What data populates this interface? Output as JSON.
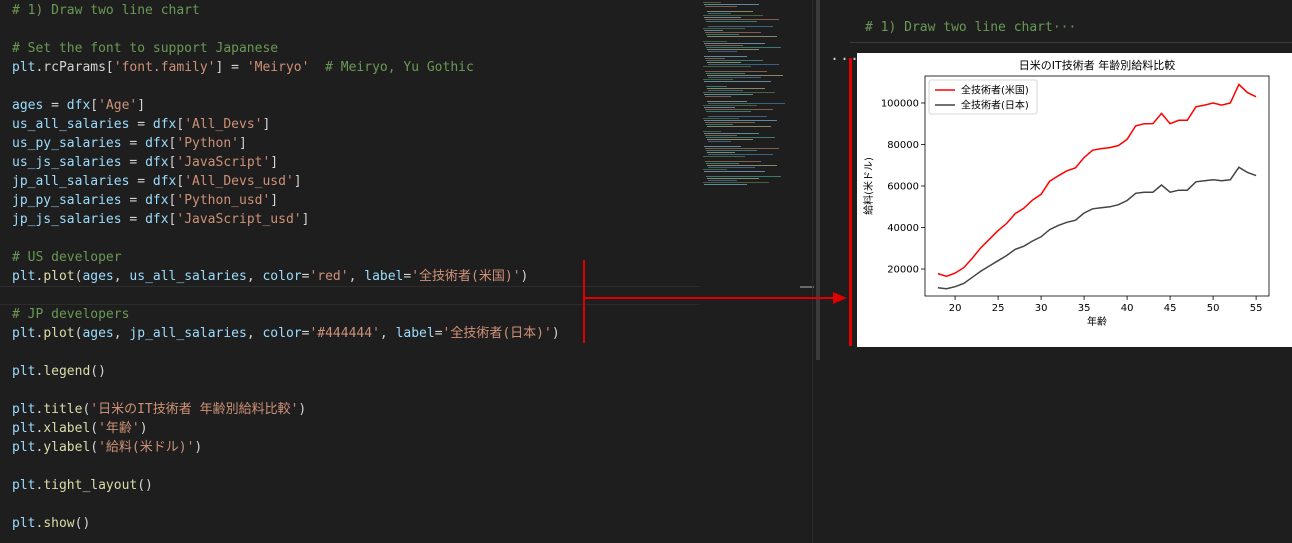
{
  "editor": {
    "lines": [
      {
        "row": 0,
        "tokens": [
          {
            "t": "# 1) Draw two line chart",
            "c": "cm"
          }
        ]
      },
      {
        "row": 2,
        "tokens": [
          {
            "t": "# Set the font to support Japanese",
            "c": "cm"
          }
        ]
      },
      {
        "row": 3,
        "tokens": [
          {
            "t": "plt",
            "c": "var"
          },
          {
            "t": ".rcParams[",
            "c": "op"
          },
          {
            "t": "'font.family'",
            "c": "str"
          },
          {
            "t": "] = ",
            "c": "op"
          },
          {
            "t": "'Meiryo'",
            "c": "str"
          },
          {
            "t": "  # Meiryo, Yu Gothic",
            "c": "cm"
          }
        ]
      },
      {
        "row": 5,
        "tokens": [
          {
            "t": "ages",
            "c": "var"
          },
          {
            "t": " = ",
            "c": "op"
          },
          {
            "t": "dfx",
            "c": "var"
          },
          {
            "t": "[",
            "c": "op"
          },
          {
            "t": "'Age'",
            "c": "str"
          },
          {
            "t": "]",
            "c": "op"
          }
        ]
      },
      {
        "row": 6,
        "tokens": [
          {
            "t": "us_all_salaries",
            "c": "var"
          },
          {
            "t": " = ",
            "c": "op"
          },
          {
            "t": "dfx",
            "c": "var"
          },
          {
            "t": "[",
            "c": "op"
          },
          {
            "t": "'All_Devs'",
            "c": "str"
          },
          {
            "t": "]",
            "c": "op"
          }
        ]
      },
      {
        "row": 7,
        "tokens": [
          {
            "t": "us_py_salaries",
            "c": "var"
          },
          {
            "t": " = ",
            "c": "op"
          },
          {
            "t": "dfx",
            "c": "var"
          },
          {
            "t": "[",
            "c": "op"
          },
          {
            "t": "'Python'",
            "c": "str"
          },
          {
            "t": "]",
            "c": "op"
          }
        ]
      },
      {
        "row": 8,
        "tokens": [
          {
            "t": "us_js_salaries",
            "c": "var"
          },
          {
            "t": " = ",
            "c": "op"
          },
          {
            "t": "dfx",
            "c": "var"
          },
          {
            "t": "[",
            "c": "op"
          },
          {
            "t": "'JavaScript'",
            "c": "str"
          },
          {
            "t": "]",
            "c": "op"
          }
        ]
      },
      {
        "row": 9,
        "tokens": [
          {
            "t": "jp_all_salaries",
            "c": "var"
          },
          {
            "t": " = ",
            "c": "op"
          },
          {
            "t": "dfx",
            "c": "var"
          },
          {
            "t": "[",
            "c": "op"
          },
          {
            "t": "'All_Devs_usd'",
            "c": "str"
          },
          {
            "t": "]",
            "c": "op"
          }
        ]
      },
      {
        "row": 10,
        "tokens": [
          {
            "t": "jp_py_salaries",
            "c": "var"
          },
          {
            "t": " = ",
            "c": "op"
          },
          {
            "t": "dfx",
            "c": "var"
          },
          {
            "t": "[",
            "c": "op"
          },
          {
            "t": "'Python_usd'",
            "c": "str"
          },
          {
            "t": "]",
            "c": "op"
          }
        ]
      },
      {
        "row": 11,
        "tokens": [
          {
            "t": "jp_js_salaries",
            "c": "var"
          },
          {
            "t": " = ",
            "c": "op"
          },
          {
            "t": "dfx",
            "c": "var"
          },
          {
            "t": "[",
            "c": "op"
          },
          {
            "t": "'JavaScript_usd'",
            "c": "str"
          },
          {
            "t": "]",
            "c": "op"
          }
        ]
      },
      {
        "row": 13,
        "tokens": [
          {
            "t": "# US developer",
            "c": "cm"
          }
        ]
      },
      {
        "row": 14,
        "tokens": [
          {
            "t": "plt",
            "c": "var"
          },
          {
            "t": ".",
            "c": "op"
          },
          {
            "t": "plot",
            "c": "fn"
          },
          {
            "t": "(",
            "c": "op"
          },
          {
            "t": "ages",
            "c": "var"
          },
          {
            "t": ", ",
            "c": "op"
          },
          {
            "t": "us_all_salaries",
            "c": "var"
          },
          {
            "t": ", ",
            "c": "op"
          },
          {
            "t": "color",
            "c": "var"
          },
          {
            "t": "=",
            "c": "op"
          },
          {
            "t": "'red'",
            "c": "str"
          },
          {
            "t": ", ",
            "c": "op"
          },
          {
            "t": "label",
            "c": "var"
          },
          {
            "t": "=",
            "c": "op"
          },
          {
            "t": "'全技術者(米国)'",
            "c": "str"
          },
          {
            "t": ")",
            "c": "op"
          }
        ]
      },
      {
        "row": 15,
        "tokens": [],
        "current": true
      },
      {
        "row": 16,
        "tokens": [
          {
            "t": "# JP developers",
            "c": "cm"
          }
        ]
      },
      {
        "row": 17,
        "tokens": [
          {
            "t": "plt",
            "c": "var"
          },
          {
            "t": ".",
            "c": "op"
          },
          {
            "t": "plot",
            "c": "fn"
          },
          {
            "t": "(",
            "c": "op"
          },
          {
            "t": "ages",
            "c": "var"
          },
          {
            "t": ", ",
            "c": "op"
          },
          {
            "t": "jp_all_salaries",
            "c": "var"
          },
          {
            "t": ", ",
            "c": "op"
          },
          {
            "t": "color",
            "c": "var"
          },
          {
            "t": "=",
            "c": "op"
          },
          {
            "t": "'#444444'",
            "c": "str"
          },
          {
            "t": ", ",
            "c": "op"
          },
          {
            "t": "label",
            "c": "var"
          },
          {
            "t": "=",
            "c": "op"
          },
          {
            "t": "'全技術者(日本)'",
            "c": "str"
          },
          {
            "t": ")",
            "c": "op"
          }
        ]
      },
      {
        "row": 19,
        "tokens": [
          {
            "t": "plt",
            "c": "var"
          },
          {
            "t": ".",
            "c": "op"
          },
          {
            "t": "legend",
            "c": "fn"
          },
          {
            "t": "()",
            "c": "op"
          }
        ]
      },
      {
        "row": 21,
        "tokens": [
          {
            "t": "plt",
            "c": "var"
          },
          {
            "t": ".",
            "c": "op"
          },
          {
            "t": "title",
            "c": "fn"
          },
          {
            "t": "(",
            "c": "op"
          },
          {
            "t": "'日米のIT技術者 年齢別給料比較'",
            "c": "str"
          },
          {
            "t": ")",
            "c": "op"
          }
        ]
      },
      {
        "row": 22,
        "tokens": [
          {
            "t": "plt",
            "c": "var"
          },
          {
            "t": ".",
            "c": "op"
          },
          {
            "t": "xlabel",
            "c": "fn"
          },
          {
            "t": "(",
            "c": "op"
          },
          {
            "t": "'年齢'",
            "c": "str"
          },
          {
            "t": ")",
            "c": "op"
          }
        ]
      },
      {
        "row": 23,
        "tokens": [
          {
            "t": "plt",
            "c": "var"
          },
          {
            "t": ".",
            "c": "op"
          },
          {
            "t": "ylabel",
            "c": "fn"
          },
          {
            "t": "(",
            "c": "op"
          },
          {
            "t": "'給料(米ドル)'",
            "c": "str"
          },
          {
            "t": ")",
            "c": "op"
          }
        ]
      },
      {
        "row": 25,
        "tokens": [
          {
            "t": "plt",
            "c": "var"
          },
          {
            "t": ".",
            "c": "op"
          },
          {
            "t": "tight_layout",
            "c": "fn"
          },
          {
            "t": "()",
            "c": "op"
          }
        ]
      },
      {
        "row": 27,
        "tokens": [
          {
            "t": "plt",
            "c": "var"
          },
          {
            "t": ".",
            "c": "op"
          },
          {
            "t": "show",
            "c": "fn"
          },
          {
            "t": "()",
            "c": "op"
          }
        ]
      }
    ]
  },
  "output": {
    "cell_header": "# 1) Draw two line chart···",
    "more_label": "···"
  },
  "chart_data": {
    "type": "line",
    "title": "日米のIT技術者 年齢別給料比較",
    "xlabel": "年齢",
    "ylabel": "給料(米ドル)",
    "xlim": [
      16.5,
      56.5
    ],
    "ylim": [
      7000,
      113000
    ],
    "xticks": [
      20,
      25,
      30,
      35,
      40,
      45,
      50,
      55
    ],
    "yticks": [
      20000,
      40000,
      60000,
      80000,
      100000
    ],
    "legend": "upper-left",
    "grid": false,
    "x": [
      18,
      19,
      20,
      21,
      22,
      23,
      24,
      25,
      26,
      27,
      28,
      29,
      30,
      31,
      32,
      33,
      34,
      35,
      36,
      37,
      38,
      39,
      40,
      41,
      42,
      43,
      44,
      45,
      46,
      47,
      48,
      49,
      50,
      51,
      52,
      53,
      54,
      55
    ],
    "series": [
      {
        "name": "全技術者(米国)",
        "color": "#ff0000",
        "values": [
          17784,
          16500,
          18012,
          20628,
          25206,
          30252,
          34368,
          38496,
          42000,
          46752,
          49320,
          53200,
          56000,
          62316,
          64928,
          67317,
          68748,
          73752,
          77232,
          78000,
          78508,
          79536,
          82488,
          88935,
          90000,
          90056,
          95000,
          90000,
          91633,
          91660,
          98150,
          98964,
          100000,
          99000,
          100000,
          108965,
          105000,
          103000
        ]
      },
      {
        "name": "全技術者(日本)",
        "color": "#444444",
        "values": [
          11000,
          10500,
          11500,
          13000,
          16000,
          19000,
          21500,
          24000,
          26500,
          29500,
          31000,
          33500,
          35500,
          39000,
          41000,
          42500,
          43500,
          47000,
          49000,
          49500,
          50000,
          51000,
          53000,
          56500,
          57000,
          57000,
          60500,
          57000,
          58000,
          58000,
          62000,
          62500,
          63000,
          62500,
          63000,
          69000,
          66500,
          65000
        ]
      }
    ]
  }
}
